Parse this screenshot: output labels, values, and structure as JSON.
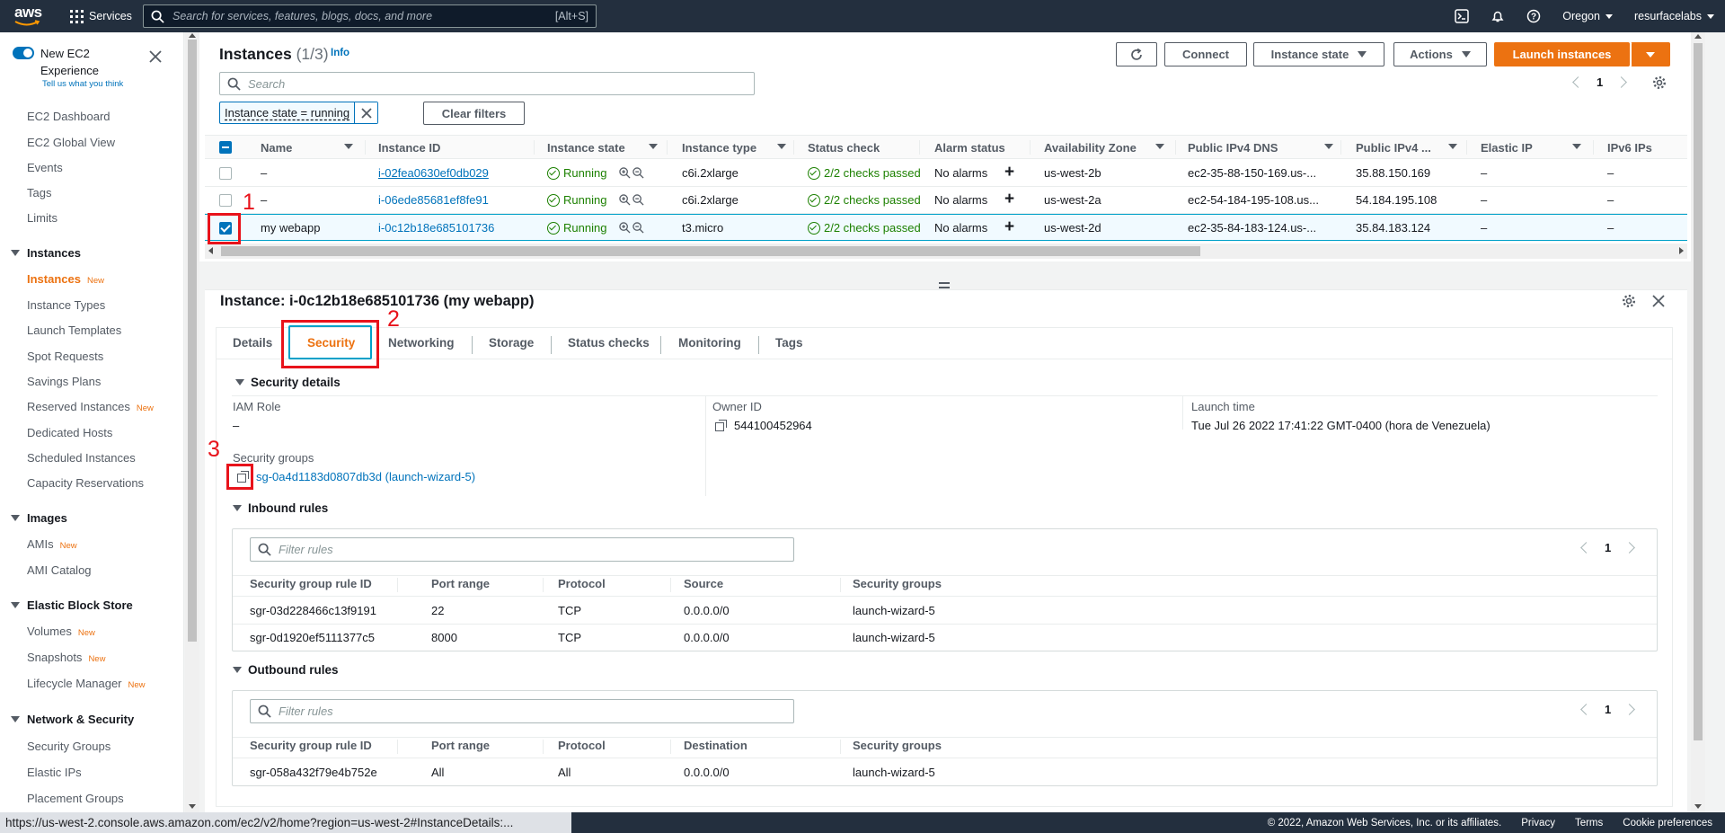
{
  "topnav": {
    "logo": "aws",
    "services": "Services",
    "search_placeholder": "Search for services, features, blogs, docs, and more",
    "search_shortcut": "[Alt+S]",
    "region": "Oregon",
    "account": "resurfacelabs",
    "icons": [
      "cloudshell-icon",
      "bell-icon",
      "help-icon"
    ]
  },
  "sidebar": {
    "new_experience_title": "New EC2 Experience",
    "new_experience_sub": "Tell us what you think",
    "top_items": [
      "EC2 Dashboard",
      "EC2 Global View",
      "Events",
      "Tags",
      "Limits"
    ],
    "new_badge": "New",
    "sections": [
      {
        "title": "Instances",
        "items": [
          {
            "label": "Instances",
            "new": true,
            "active": true
          },
          {
            "label": "Instance Types"
          },
          {
            "label": "Launch Templates"
          },
          {
            "label": "Spot Requests"
          },
          {
            "label": "Savings Plans"
          },
          {
            "label": "Reserved Instances",
            "new": true
          },
          {
            "label": "Dedicated Hosts"
          },
          {
            "label": "Scheduled Instances"
          },
          {
            "label": "Capacity Reservations"
          }
        ]
      },
      {
        "title": "Images",
        "items": [
          {
            "label": "AMIs",
            "new": true
          },
          {
            "label": "AMI Catalog"
          }
        ]
      },
      {
        "title": "Elastic Block Store",
        "items": [
          {
            "label": "Volumes",
            "new": true
          },
          {
            "label": "Snapshots",
            "new": true
          },
          {
            "label": "Lifecycle Manager",
            "new": true
          }
        ]
      },
      {
        "title": "Network & Security",
        "items": [
          {
            "label": "Security Groups"
          },
          {
            "label": "Elastic IPs"
          },
          {
            "label": "Placement Groups"
          }
        ]
      }
    ]
  },
  "instances": {
    "title": "Instances",
    "count": "(1/3)",
    "info": "Info",
    "buttons": {
      "connect": "Connect",
      "instance_state": "Instance state",
      "actions": "Actions",
      "launch": "Launch instances"
    },
    "search_placeholder": "Search",
    "filter_token": "Instance state = running",
    "clear_filters": "Clear filters",
    "page": "1",
    "columns": [
      "Name",
      "Instance ID",
      "Instance state",
      "Instance type",
      "Status check",
      "Alarm status",
      "Availability Zone",
      "Public IPv4 DNS",
      "Public IPv4 ...",
      "Elastic IP",
      "IPv6 IPs"
    ],
    "rows": [
      {
        "name": "–",
        "id": "i-02fea0630ef0db029",
        "state": "Running",
        "type": "c6i.2xlarge",
        "status": "2/2 checks passed",
        "alarm": "No alarms",
        "az": "us-west-2b",
        "dns": "ec2-35-88-150-169.us-...",
        "ipv4": "35.88.150.169",
        "eip": "–",
        "ipv6": "–",
        "selected": false
      },
      {
        "name": "–",
        "id": "i-06ede85681ef8fe91",
        "state": "Running",
        "type": "c6i.2xlarge",
        "status": "2/2 checks passed",
        "alarm": "No alarms",
        "az": "us-west-2a",
        "dns": "ec2-54-184-195-108.us...",
        "ipv4": "54.184.195.108",
        "eip": "–",
        "ipv6": "–",
        "selected": false
      },
      {
        "name": "my webapp",
        "id": "i-0c12b18e685101736",
        "state": "Running",
        "type": "t3.micro",
        "status": "2/2 checks passed",
        "alarm": "No alarms",
        "az": "us-west-2d",
        "dns": "ec2-35-84-183-124.us-...",
        "ipv4": "35.84.183.124",
        "eip": "–",
        "ipv6": "–",
        "selected": true
      }
    ]
  },
  "detail": {
    "title": "Instance: i-0c12b18e685101736 (my webapp)",
    "tabs": [
      "Details",
      "Security",
      "Networking",
      "Storage",
      "Status checks",
      "Monitoring",
      "Tags"
    ],
    "active_tab": "Security",
    "security_details": {
      "heading": "Security details",
      "iam_role_label": "IAM Role",
      "iam_role_value": "–",
      "owner_label": "Owner ID",
      "owner_value": "544100452964",
      "launch_label": "Launch time",
      "launch_value": "Tue Jul 26 2022 17:41:22 GMT-0400 (hora de Venezuela)",
      "sg_label": "Security groups",
      "sg_value": "sg-0a4d1183d0807db3d (launch-wizard-5)"
    },
    "inbound": {
      "heading": "Inbound rules",
      "filter_placeholder": "Filter rules",
      "page": "1",
      "columns": [
        "Security group rule ID",
        "Port range",
        "Protocol",
        "Source",
        "Security groups"
      ],
      "rows": [
        [
          "sgr-03d228466c13f9191",
          "22",
          "TCP",
          "0.0.0.0/0",
          "launch-wizard-5"
        ],
        [
          "sgr-0d1920ef5111377c5",
          "8000",
          "TCP",
          "0.0.0.0/0",
          "launch-wizard-5"
        ]
      ]
    },
    "outbound": {
      "heading": "Outbound rules",
      "filter_placeholder": "Filter rules",
      "page": "1",
      "columns": [
        "Security group rule ID",
        "Port range",
        "Protocol",
        "Destination",
        "Security groups"
      ],
      "rows": [
        [
          "sgr-058a432f79e4b752e",
          "All",
          "All",
          "0.0.0.0/0",
          "launch-wizard-5"
        ]
      ]
    }
  },
  "annotations": [
    "1",
    "2",
    "3"
  ],
  "annotation_color": "#e8131b",
  "colors": {
    "accent": "#ec7211",
    "link": "#0073bb",
    "nav": "#232f3e",
    "success": "#1d8102"
  },
  "footer": {
    "status_url": "https://us-west-2.console.aws.amazon.com/ec2/v2/home?region=us-west-2#InstanceDetails:...",
    "copyright": "© 2022, Amazon Web Services, Inc. or its affiliates.",
    "links": [
      "Privacy",
      "Terms",
      "Cookie preferences"
    ]
  }
}
